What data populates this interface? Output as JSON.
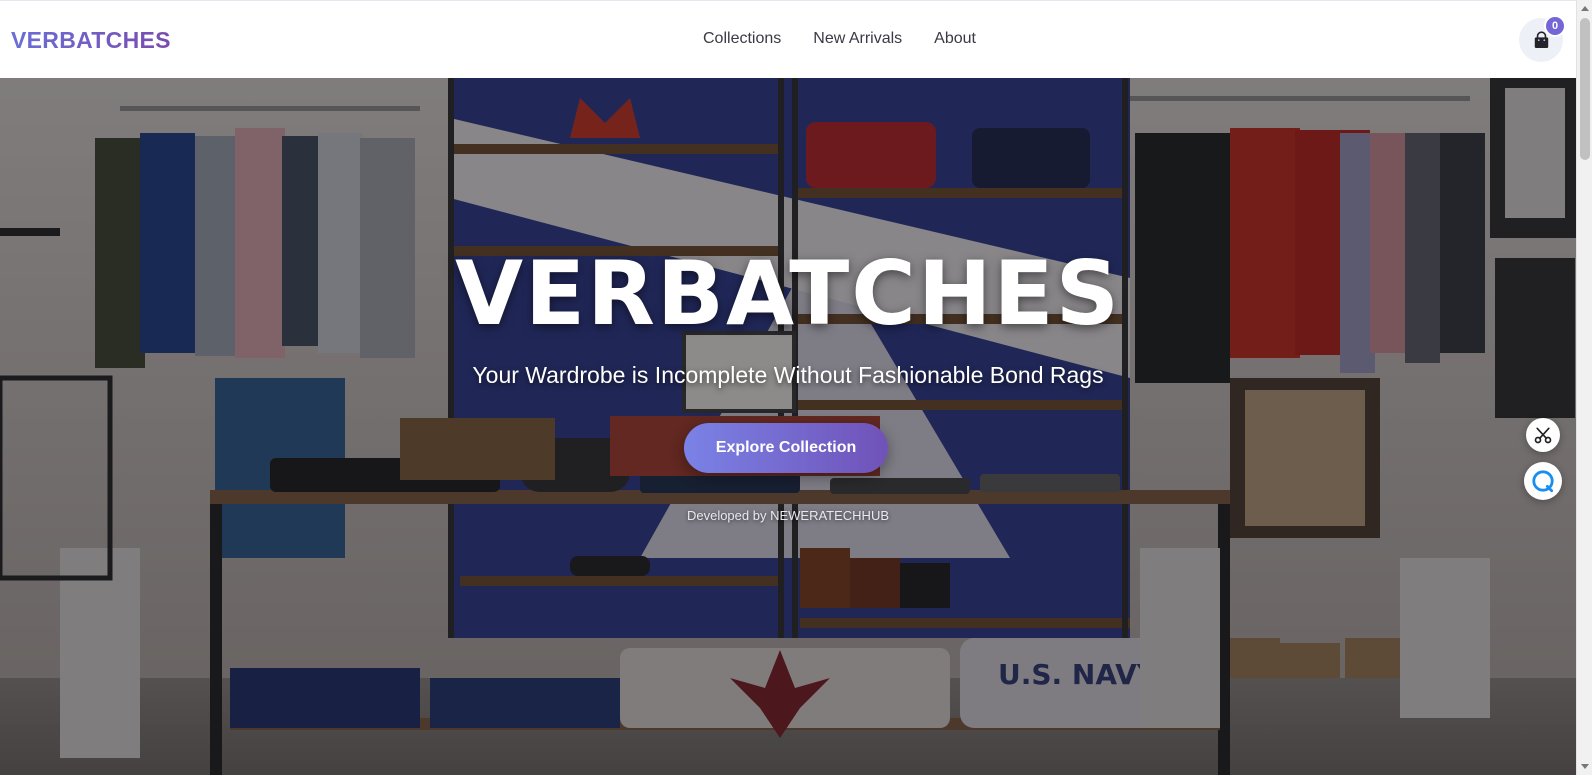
{
  "navbar": {
    "brand": "VERBATCHES",
    "links": [
      "Collections",
      "New Arrivals",
      "About"
    ],
    "cart_icon": "shopping-bag-icon",
    "cart_count": "0"
  },
  "hero": {
    "title": "VERBATCHES",
    "subtitle": "Your Wardrobe is Incomplete Without Fashionable Bond Rags",
    "cta_label": "Explore Collection",
    "credit": "Developed by NEWERATECHHUB",
    "background": "clothing-store-interior-photo"
  },
  "widgets": {
    "scissors_icon": "scissors-icon",
    "chat_icon": "chat-bubble-icon"
  },
  "colors": {
    "brand_gradient_start": "#6a6fd6",
    "brand_gradient_end": "#7b4bb0",
    "cta_gradient_start": "#7a82e6",
    "cta_gradient_end": "#7052b8",
    "badge": "#7566d8"
  }
}
